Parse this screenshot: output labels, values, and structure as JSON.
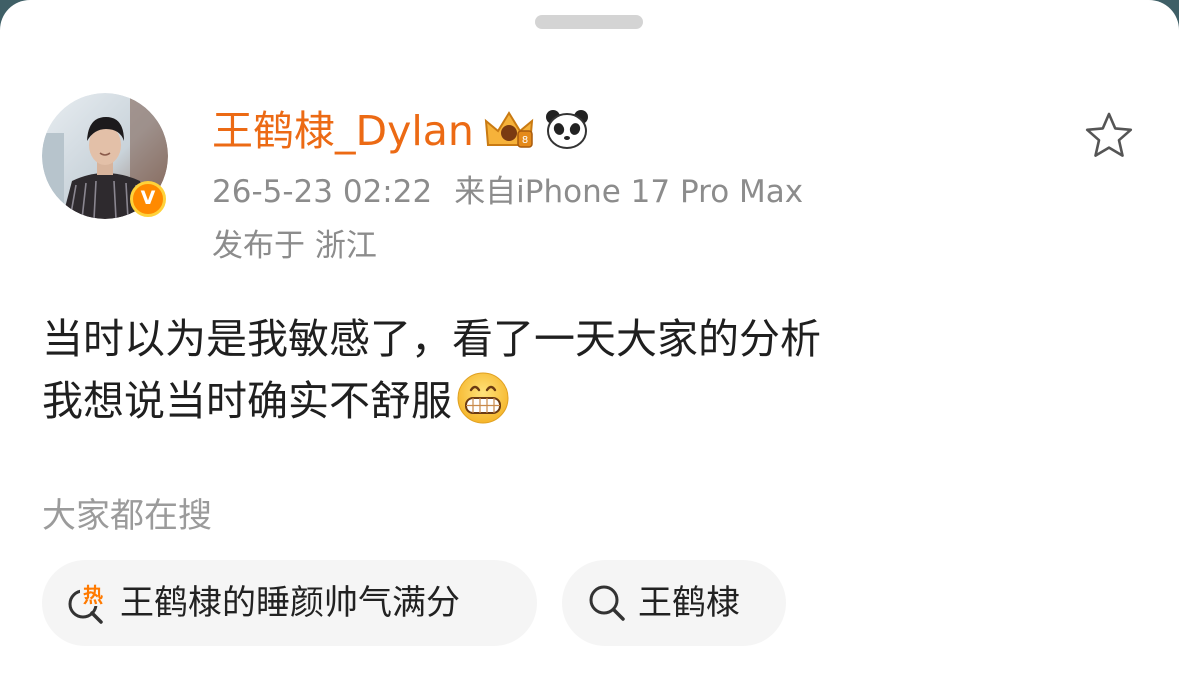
{
  "post": {
    "author": "王鹤棣_Dylan",
    "timestamp": "26-5-23 02:22",
    "source": "来自iPhone 17 Pro Max",
    "location": "发布于 浙江",
    "verified_mark": "V",
    "badges": [
      "crown-badge-icon",
      "panda-badge-icon"
    ],
    "text_lines": [
      "当时以为是我敏感了，看了一天大家的分析",
      "我想说当时确实不舒服"
    ],
    "emoji": "grinning-face-icon",
    "favorite_icon": "star-outline-icon"
  },
  "search": {
    "title": "大家都在搜",
    "chips": [
      {
        "label": "王鹤棣的睡颜帅气满分",
        "icon": "hot-search-icon",
        "hot_mark": "热"
      },
      {
        "label": "王鹤棣",
        "icon": "search-icon"
      }
    ]
  },
  "colors": {
    "username": "#ec6a14",
    "meta": "#8c8c8c",
    "chip_background": "#f5f5f5",
    "hot": "#ff7a00"
  }
}
